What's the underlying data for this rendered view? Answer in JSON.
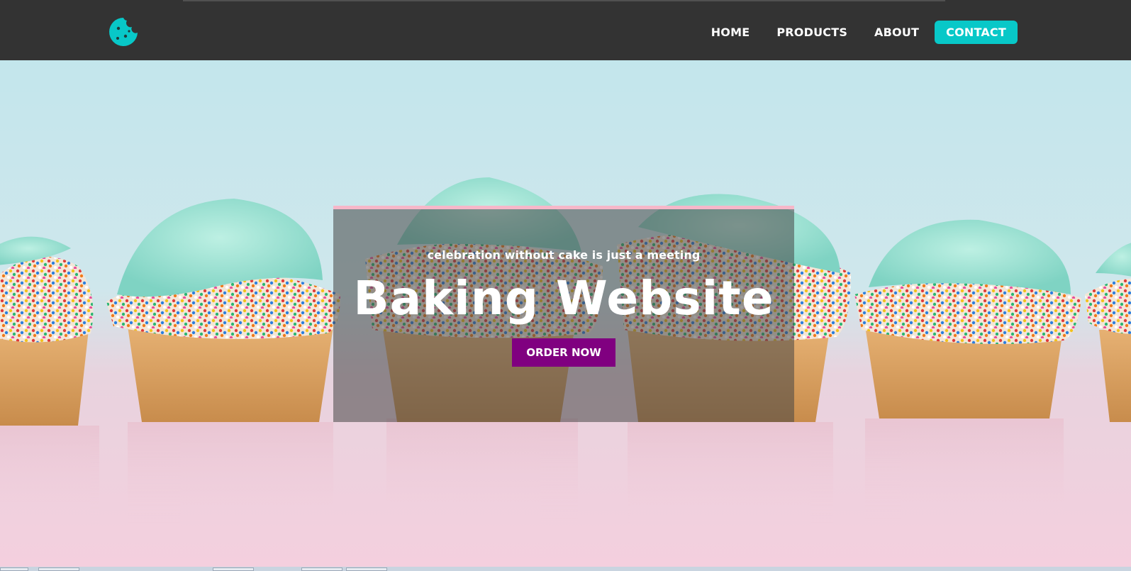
{
  "navbar": {
    "logo_icon": "cookie-icon",
    "links": [
      {
        "label": "HOME"
      },
      {
        "label": "PRODUCTS"
      },
      {
        "label": "ABOUT"
      },
      {
        "label": "CONTACT",
        "active": true
      }
    ],
    "accent_color": "#08c8c8",
    "background_color": "#333333"
  },
  "hero": {
    "tagline": "celebration without cake is just a meeting",
    "title": "Baking Website",
    "cta_label": "ORDER NOW",
    "cta_color": "#800080",
    "overlay_border_color": "#f6b7c9",
    "background_image": "cupcakes-photo"
  }
}
